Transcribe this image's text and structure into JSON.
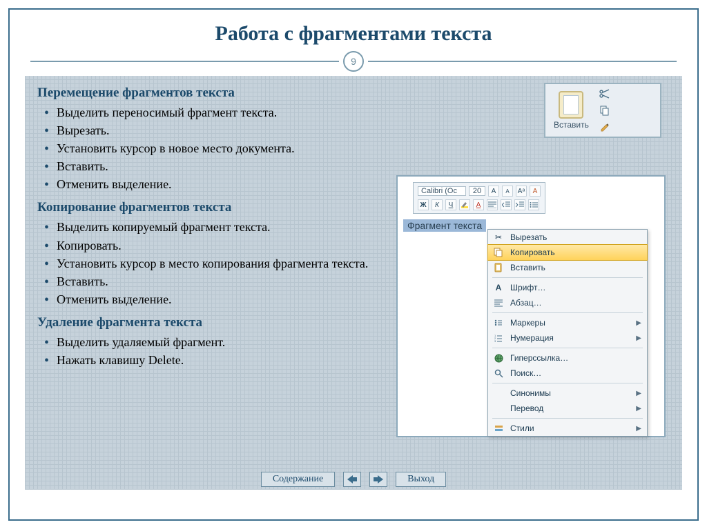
{
  "title": "Работа с фрагментами текста",
  "slide_number": "9",
  "sections": {
    "move": {
      "heading": "Перемещение фрагментов текста",
      "items": [
        "Выделить переносимый фрагмент текста.",
        "Вырезать.",
        "Установить курсор в новое место документа.",
        "Вставить.",
        "Отменить выделение."
      ]
    },
    "copy": {
      "heading": "Копирование фрагментов текста",
      "items": [
        "Выделить копируемый фрагмент текста.",
        "Копировать.",
        "Установить курсор в место копирования фрагмента текста.",
        "Вставить.",
        "Отменить выделение."
      ]
    },
    "delete": {
      "heading": "Удаление фрагмента текста",
      "items": [
        "Выделить удаляемый фрагмент.",
        "Нажать клавишу Delete."
      ]
    }
  },
  "nav": {
    "contents": "Содержание",
    "exit": "Выход"
  },
  "office_clipboard": {
    "paste": "Вставить"
  },
  "mini_toolbar": {
    "font": "Calibri (Ос",
    "size": "20",
    "bold": "Ж",
    "italic": "К",
    "underline": "Ч"
  },
  "selected_text": "Фрагмент текста",
  "context_menu": {
    "cut": "Вырезать",
    "copy": "Копировать",
    "paste": "Вставить",
    "font": "Шрифт…",
    "paragraph": "Абзац…",
    "bullets": "Маркеры",
    "numbering": "Нумерация",
    "hyperlink": "Гиперссылка…",
    "search": "Поиск…",
    "synonyms": "Синонимы",
    "translate": "Перевод",
    "styles": "Стили"
  }
}
